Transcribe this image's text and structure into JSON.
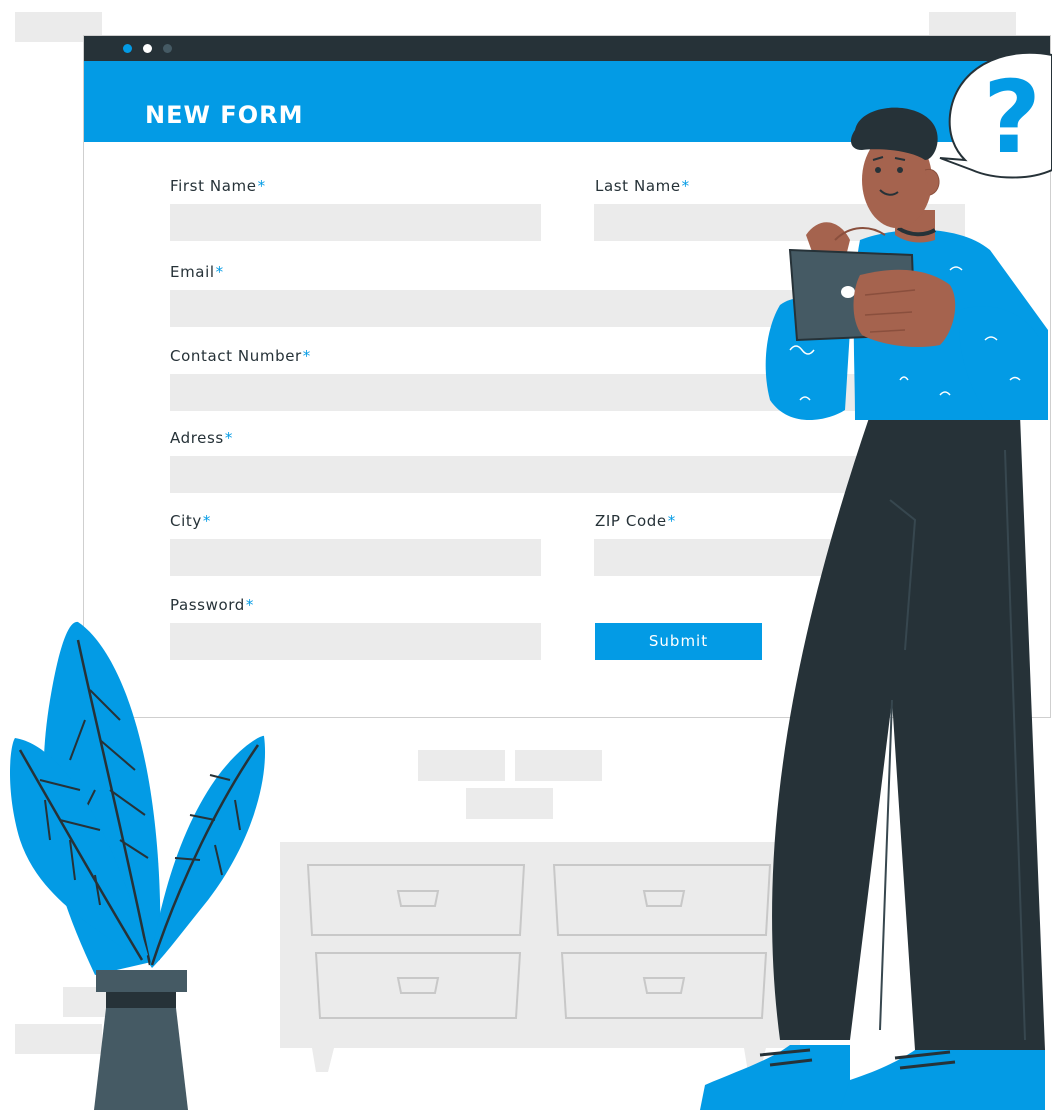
{
  "form": {
    "title": "NEW FORM",
    "required_marker": "*",
    "fields": {
      "first_name": {
        "label": "First Name",
        "value": ""
      },
      "last_name": {
        "label": "Last Name",
        "value": ""
      },
      "email": {
        "label": "Email",
        "value": ""
      },
      "contact_number": {
        "label": "Contact Number",
        "value": ""
      },
      "address": {
        "label": "Adress",
        "value": ""
      },
      "city": {
        "label": "City",
        "value": ""
      },
      "zip_code": {
        "label": "ZIP Code",
        "value": ""
      },
      "password": {
        "label": "Password",
        "value": ""
      }
    },
    "submit_label": "Submit"
  },
  "window": {
    "dots": [
      "#039be5",
      "#ffffff",
      "#455a64"
    ]
  },
  "speech_bubble": {
    "text": "?"
  },
  "colors": {
    "accent": "#039be5",
    "dark": "#263238",
    "input_bg": "#ebebeb",
    "skin": "#a5634e"
  },
  "icons": {
    "plant": "potted-plant-illustration",
    "person": "person-holding-tablet-illustration",
    "bubble": "question-speech-bubble"
  }
}
